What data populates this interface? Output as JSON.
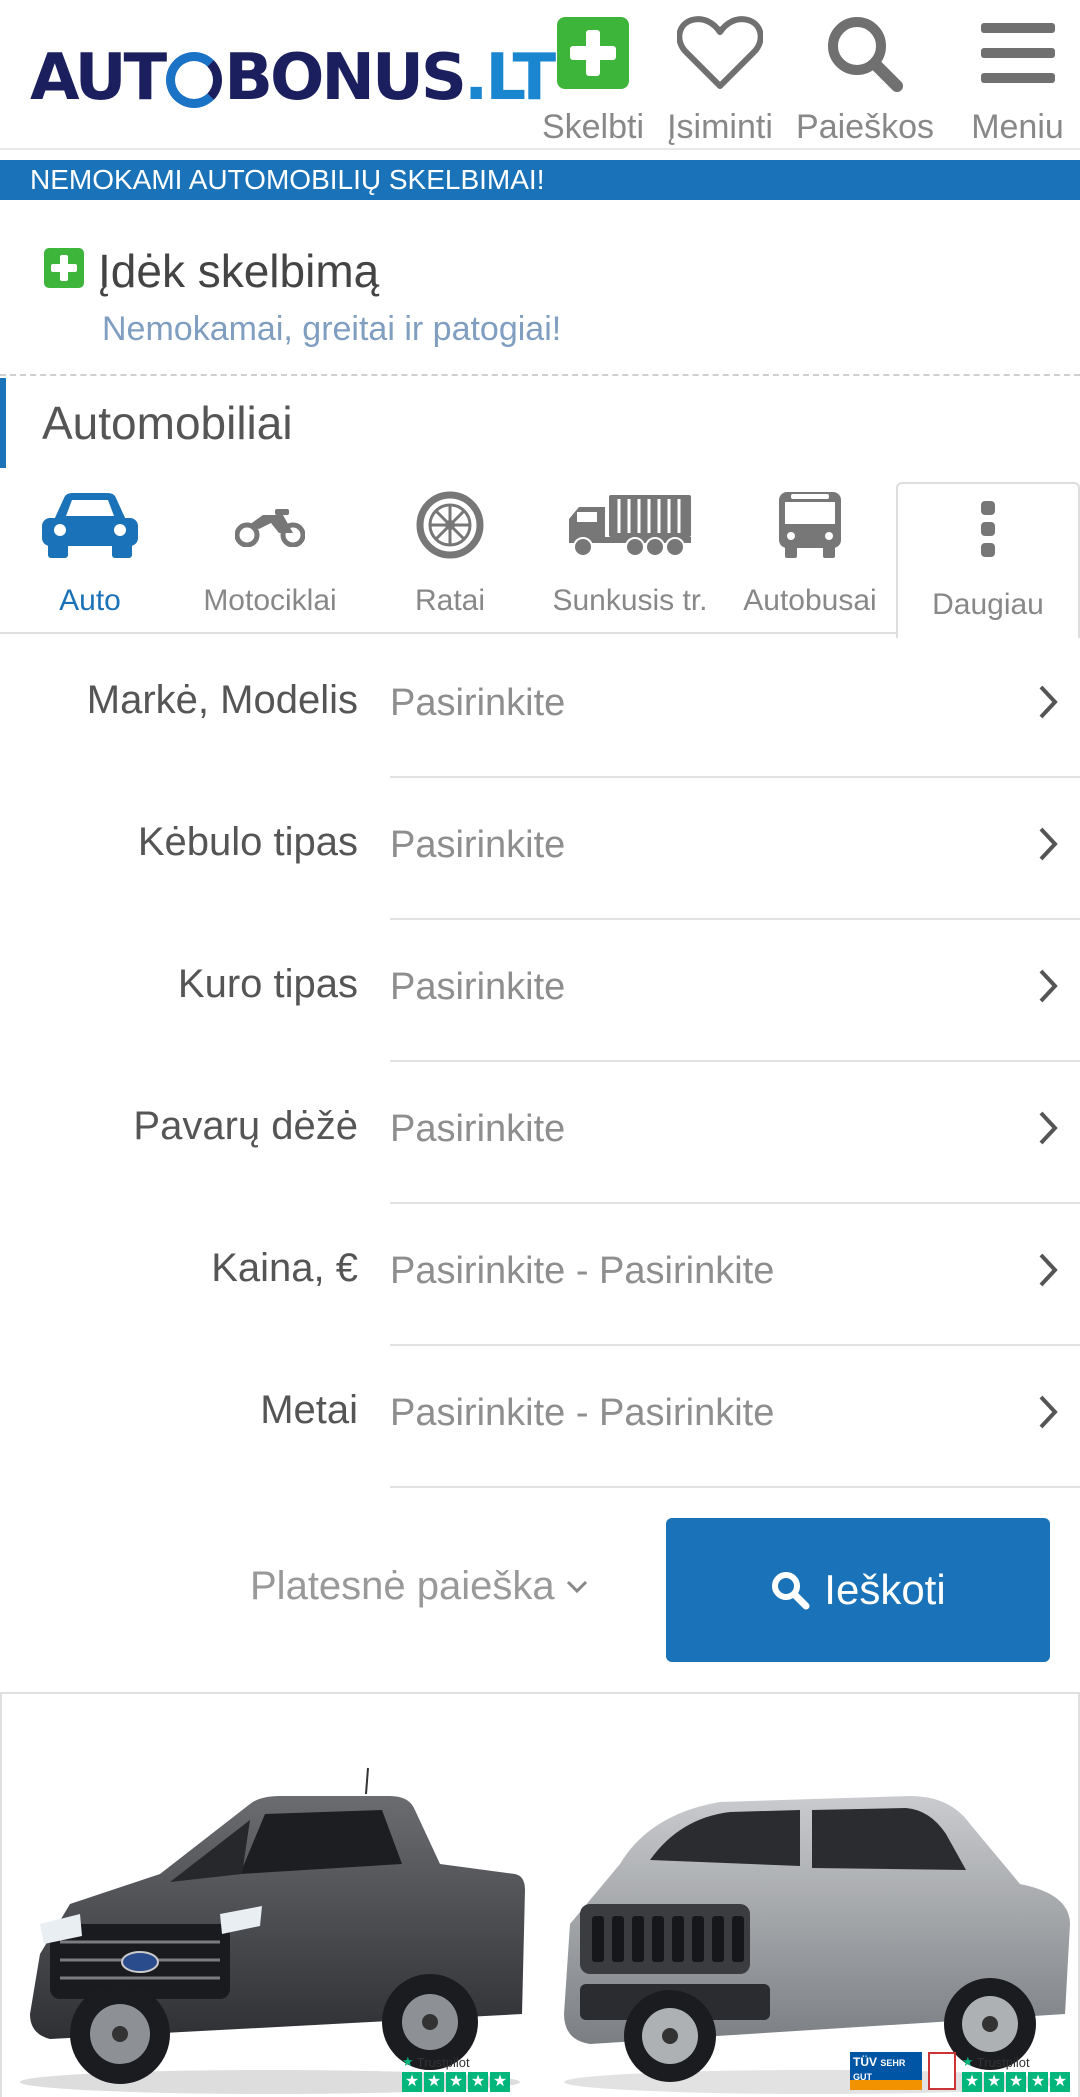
{
  "header": {
    "logo_main": "AUT",
    "logo_rest": "BONUS",
    "logo_tld": ".LT",
    "nav": [
      {
        "label": "Skelbti",
        "icon": "plus-square-icon"
      },
      {
        "label": "Įsiminti",
        "icon": "heart-icon"
      },
      {
        "label": "Paieškos",
        "icon": "search-icon"
      },
      {
        "label": "Meniu",
        "icon": "hamburger-icon"
      }
    ]
  },
  "banner": {
    "text": "NEMOKAMI AUTOMOBILIŲ SKELBIMAI!"
  },
  "post_ad": {
    "title": "Įdėk skelbimą",
    "subtitle": "Nemokamai, greitai ir patogiai!"
  },
  "section": {
    "title": "Automobiliai"
  },
  "categories": [
    {
      "label": "Auto",
      "icon": "car-icon",
      "active": true
    },
    {
      "label": "Motociklai",
      "icon": "motorcycle-icon",
      "active": false
    },
    {
      "label": "Ratai",
      "icon": "wheel-icon",
      "active": false
    },
    {
      "label": "Sunkusis tr.",
      "icon": "truck-icon",
      "active": false
    },
    {
      "label": "Autobusai",
      "icon": "bus-icon",
      "active": false
    },
    {
      "label": "Daugiau",
      "icon": "more-vertical-icon",
      "active": false
    }
  ],
  "filters": [
    {
      "label": "Markė, Modelis",
      "value": "Pasirinkite"
    },
    {
      "label": "Kėbulo tipas",
      "value": "Pasirinkite"
    },
    {
      "label": "Kuro tipas",
      "value": "Pasirinkite"
    },
    {
      "label": "Pavarų dėžė",
      "value": "Pasirinkite"
    },
    {
      "label": "Kaina, €",
      "value": "Pasirinkite - Pasirinkite"
    },
    {
      "label": "Metai",
      "value": "Pasirinkite - Pasirinkite"
    }
  ],
  "actions": {
    "more_search": "Platesnė paieška",
    "search": "Ieškoti"
  },
  "promo": {
    "trustpilot_label": "Trustpilot",
    "tuv_label": "TÜV",
    "tuv_badge": "SEHR GUT"
  },
  "colors": {
    "accent": "#1a73b8",
    "green": "#3db53b",
    "logo_navy": "#1c1f5e"
  }
}
